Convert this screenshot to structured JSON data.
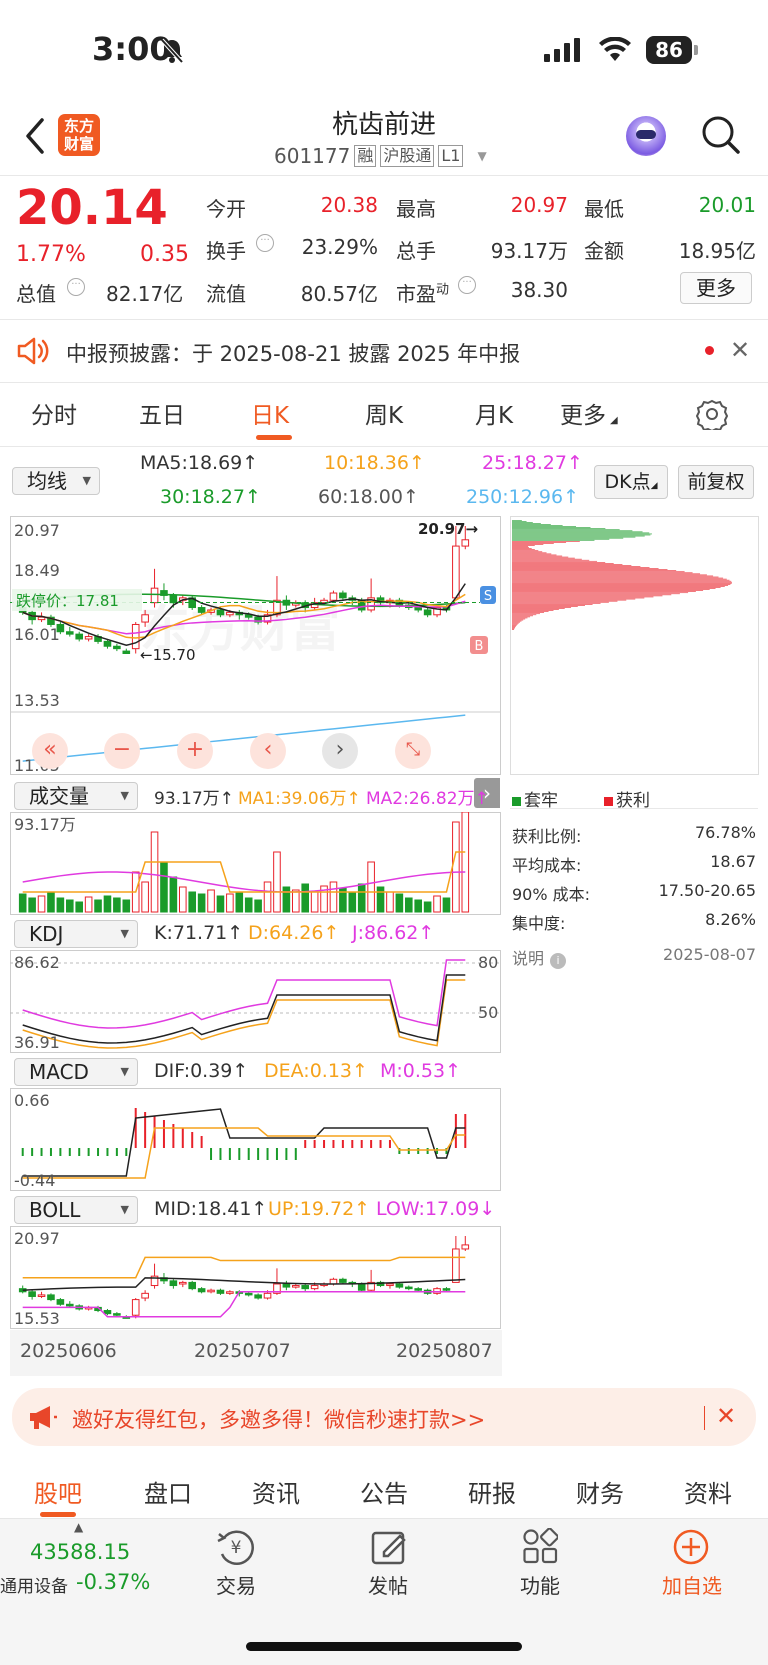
{
  "status_bar": {
    "time": "3:00",
    "battery": "86"
  },
  "header": {
    "brand_logo": "东方财富",
    "title": "杭齿前进",
    "code": "601177",
    "tags": [
      "融",
      "沪股通",
      "L1"
    ]
  },
  "quote": {
    "price": "20.14",
    "pct": "1.77%",
    "change": "0.35",
    "open_label": "今开",
    "open": "20.38",
    "high_label": "最高",
    "high": "20.97",
    "low_label": "最低",
    "low": "20.01",
    "turnover_label": "换手",
    "turnover": "23.29%",
    "vol_label": "总手",
    "vol": "93.17万",
    "amount_label": "金额",
    "amount": "18.95亿",
    "mcap_label": "总值",
    "mcap": "82.17亿",
    "float_label": "流值",
    "float": "80.57亿",
    "pe_label": "市盈",
    "pe_sup": "动",
    "pe": "38.30",
    "more_button": "更多"
  },
  "notice": {
    "text": "中报预披露：于 2025-08-21 披露 2025 年中报"
  },
  "tabs": {
    "items": [
      "分时",
      "五日",
      "日K",
      "周K",
      "月K",
      "更多"
    ],
    "active": 2
  },
  "ma": {
    "select": "均线",
    "ma5": "MA5:18.69",
    "ma10": "10:18.36",
    "ma25": "25:18.27",
    "ma30": "30:18.27",
    "ma60": "60:18.00",
    "ma250": "250:12.96",
    "dk": "DK点",
    "adjust": "前复权"
  },
  "main_chart": {
    "y_labels": [
      "20.97",
      "18.49",
      "16.01",
      "13.53",
      "11.05"
    ],
    "max_label": "20.97",
    "min_label": "15.70",
    "limit_down": "跌停价：17.81",
    "watermark": "东方财富",
    "marker_s": "S",
    "marker_b": "B"
  },
  "chip": {
    "legend_loss": "套牢",
    "legend_profit": "获利",
    "rows": [
      {
        "label": "获利比例:",
        "value": "76.78%"
      },
      {
        "label": "平均成本:",
        "value": "18.67"
      },
      {
        "label": "90% 成本:",
        "value": "17.50-20.65"
      },
      {
        "label": "集中度:",
        "value": "8.26%"
      }
    ],
    "note": "说明",
    "date": "2025-08-07"
  },
  "volume": {
    "select": "成交量",
    "v": "93.17万",
    "ma1": "MA1:39.06万",
    "ma2": "MA2:26.82万",
    "y_top": "93.17万"
  },
  "kdj": {
    "select": "KDJ",
    "k": "K:71.71",
    "d": "D:64.26",
    "j": "J:86.62",
    "y_top": "86.62",
    "y_bottom": "36.91",
    "level_80": "80",
    "level_50": "50"
  },
  "macd": {
    "select": "MACD",
    "dif": "DIF:0.39",
    "dea": "DEA:0.13",
    "m": "M:0.53",
    "y_top": "0.66",
    "y_bottom": "-0.44"
  },
  "boll": {
    "select": "BOLL",
    "mid": "MID:18.41",
    "up": "UP:19.72",
    "low": "LOW:17.09",
    "y_top": "20.97",
    "y_bottom": "15.53"
  },
  "dates": [
    "20250606",
    "20250707",
    "20250807"
  ],
  "banner": {
    "text": "邀好友得红包，多邀多得！微信秒速打款>>"
  },
  "bottom_tabs": {
    "items": [
      "股吧",
      "盘口",
      "资讯",
      "公告",
      "研报",
      "财务",
      "资料"
    ],
    "active": 0
  },
  "footer": {
    "index_value": "43588.15",
    "index_name": "通用设备",
    "index_pct": "-0.37%",
    "trade": "交易",
    "post": "发帖",
    "func": "功能",
    "add": "加自选"
  },
  "colors": {
    "up": "#e8212a",
    "down": "#1a9b2a",
    "accent": "#ff6600",
    "ma10": "#f5a21b",
    "ma25": "#e03ae0",
    "ma250": "#5bb8ef"
  }
}
